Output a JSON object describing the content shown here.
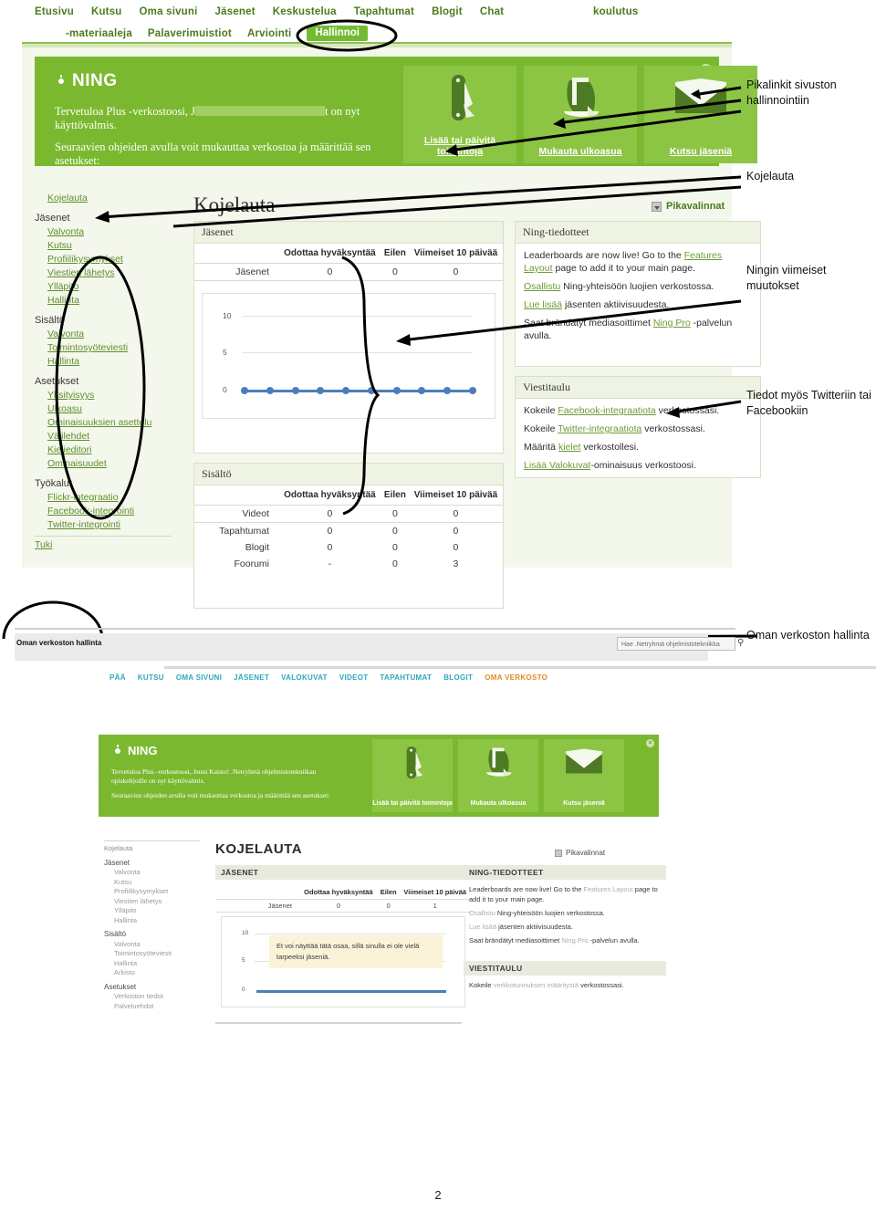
{
  "top_nav": {
    "row1": [
      "Etusivu",
      "Kutsu",
      "Oma sivuni",
      "Jäsenet",
      "Keskustelua",
      "Tapahtumat",
      "Blogit",
      "Chat"
    ],
    "row2": [
      "-materiaaleja",
      "Palaverimuistiot",
      "Arviointi"
    ],
    "right_label": "koulutus",
    "active_tab": "Hallinnoi"
  },
  "shot1": {
    "banner": {
      "logo": "NING",
      "welcome_line1_pre": "Tervetuloa Plus -verkostoosi, J",
      "welcome_line1_post": "t on nyt käyttövalmis.",
      "welcome_line2": "Seuraavien ohjeiden avulla voit mukauttaa verkostoa ja määrittää sen asetukset:",
      "close": "×",
      "tiles": [
        {
          "icon": "pocketknife-icon",
          "label": "Lisää tai päivitä toimintoja"
        },
        {
          "icon": "paint-bucket-icon",
          "label": "Mukauta ulkoasua"
        },
        {
          "icon": "envelope-icon",
          "label": "Kutsu jäseniä"
        }
      ]
    },
    "sidebar": [
      {
        "type": "link",
        "label": "Kojelauta"
      },
      {
        "type": "group",
        "label": "Jäsenet"
      },
      {
        "type": "link",
        "label": "Valvonta"
      },
      {
        "type": "link",
        "label": "Kutsu"
      },
      {
        "type": "link",
        "label": "Profiilikysymykset"
      },
      {
        "type": "link",
        "label": "Viestien lähetys"
      },
      {
        "type": "link",
        "label": "Ylläpito"
      },
      {
        "type": "link",
        "label": "Hallinta"
      },
      {
        "type": "group",
        "label": "Sisältö"
      },
      {
        "type": "link",
        "label": "Valvonta"
      },
      {
        "type": "link",
        "label": "Toimintosyöteviesti"
      },
      {
        "type": "link",
        "label": "Hallinta"
      },
      {
        "type": "group",
        "label": "Asetukset"
      },
      {
        "type": "link",
        "label": "Yksityisyys"
      },
      {
        "type": "link",
        "label": "Ulkoasu"
      },
      {
        "type": "link",
        "label": "Ominaisuuksien asettelu"
      },
      {
        "type": "link",
        "label": "Välilehdet"
      },
      {
        "type": "link",
        "label": "Kielieditori"
      },
      {
        "type": "link",
        "label": "Ominaisuudet"
      },
      {
        "type": "group",
        "label": "Työkalut"
      },
      {
        "type": "link",
        "label": "Flickr-integraatio"
      },
      {
        "type": "link",
        "label": "Facebook-integrointi"
      },
      {
        "type": "link",
        "label": "Twitter-integrointi"
      },
      {
        "type": "link0",
        "label": "Tuki"
      }
    ],
    "dashboard_title": "Kojelauta",
    "quick_links": "Pikavalinnat",
    "members_panel": {
      "title": "Jäsenet",
      "headers": [
        "",
        "Odottaa hyväksyntää",
        "Eilen",
        "Viimeiset 10 päivää"
      ],
      "rows": [
        [
          "Jäsenet",
          "0",
          "0",
          "0"
        ]
      ]
    },
    "content_panel": {
      "title": "Sisältö",
      "headers": [
        "",
        "Odottaa hyväksyntää",
        "Eilen",
        "Viimeiset 10 päivää"
      ],
      "rows": [
        [
          "Videot",
          "0",
          "0",
          "0"
        ],
        [
          "Tapahtumat",
          "0",
          "0",
          "0"
        ],
        [
          "Blogit",
          "0",
          "0",
          "0"
        ],
        [
          "Foorumi",
          "-",
          "0",
          "3"
        ]
      ]
    },
    "ning_panel": {
      "title": "Ning-tiedotteet",
      "lines": [
        {
          "pre": "Leaderboards are now live! Go to the ",
          "link": "Features Layout",
          "post": " page to add it to your main page."
        },
        {
          "pre": "",
          "link": "Osallistu",
          "post": " Ning-yhteisöön luojien verkostossa."
        },
        {
          "pre": "",
          "link": "Lue lisää",
          "post": " jäsenten aktiivisuudesta."
        },
        {
          "pre": "Saat brändätyt mediasoittimet ",
          "link": "Ning Pro",
          "post": " -palvelun avulla."
        }
      ]
    },
    "message_panel": {
      "title": "Viestitaulu",
      "lines": [
        {
          "pre": "Kokeile ",
          "link": "Facebook-integraatiota",
          "post": " verkostossasi."
        },
        {
          "pre": "Kokeile ",
          "link": "Twitter-integraatiota",
          "post": " verkostossasi."
        },
        {
          "pre": "Määritä ",
          "link": "kielet",
          "post": " verkostollesi."
        },
        {
          "pre": "",
          "link": "Lisää Valokuvat",
          "post": "-ominaisuus verkostoosi."
        }
      ]
    },
    "chart_data": {
      "type": "line",
      "title": "Jäsenet",
      "x": [
        1,
        2,
        3,
        4,
        5,
        6,
        7,
        8,
        9,
        10
      ],
      "values": [
        0,
        0,
        0,
        0,
        0,
        0,
        0,
        0,
        0,
        0
      ],
      "yticks": [
        "10",
        "5",
        "0"
      ],
      "ylim": [
        0,
        10
      ],
      "xlabel": "",
      "ylabel": "",
      "grid": true,
      "legend": "none",
      "series_color": "#4a7ebb"
    }
  },
  "annotations": [
    {
      "id": "anno-1",
      "text": "Pikalinkit sivuston hallinnointiin"
    },
    {
      "id": "anno-2",
      "text": "Kojelauta"
    },
    {
      "id": "anno-3",
      "text": "Ningin viimeiset muutokset"
    },
    {
      "id": "anno-4",
      "text": "Tiedot myös Twitteriin tai Facebookiin"
    },
    {
      "id": "anno-5",
      "text": "Oman verkoston hallinta"
    }
  ],
  "shot2": {
    "banner_title": "Oman verkoston hallinta",
    "search_placeholder": "Hae .Netryhmä ohjelmistotekniikka",
    "search_icon": "magnifier-icon",
    "nav": [
      {
        "label": "PÄÄ",
        "active": false
      },
      {
        "label": "KUTSU",
        "active": false
      },
      {
        "label": "OMA SIVUNI",
        "active": false
      },
      {
        "label": "JÄSENET",
        "active": false
      },
      {
        "label": "VALOKUVAT",
        "active": false
      },
      {
        "label": "VIDEOT",
        "active": false
      },
      {
        "label": "TAPAHTUMAT",
        "active": false
      },
      {
        "label": "BLOGIT",
        "active": false
      },
      {
        "label": "OMA VERKOSTO",
        "active": true
      }
    ]
  },
  "shot3": {
    "banner": {
      "logo": "NING",
      "welcome_line1": "Tervetuloa Plus -verkostoosi, Jenni Kaisto! .Netryhmä ohjelmistotekniikan opiskelijoille on nyt käyttövalmis.",
      "welcome_line2": "Seuraavien ohjeiden avulla voit mukauttaa verkostoa ja määrittää sen asetukset:",
      "close": "×",
      "tiles": [
        {
          "icon": "pocketknife-icon",
          "label": "Lisää tai päivitä toimintoja"
        },
        {
          "icon": "paint-bucket-icon",
          "label": "Mukauta ulkoasua"
        },
        {
          "icon": "envelope-icon",
          "label": "Kutsu jäseniä"
        }
      ]
    },
    "sidebar": [
      {
        "type": "link0",
        "label": "Kojelauta"
      },
      {
        "type": "group",
        "label": "Jäsenet"
      },
      {
        "type": "link",
        "label": "Valvonta"
      },
      {
        "type": "link",
        "label": "Kutsu"
      },
      {
        "type": "link",
        "label": "Profiilikysymykset"
      },
      {
        "type": "link",
        "label": "Viestien lähetys"
      },
      {
        "type": "link",
        "label": "Ylläpito"
      },
      {
        "type": "link",
        "label": "Hallinta"
      },
      {
        "type": "group",
        "label": "Sisältö"
      },
      {
        "type": "link",
        "label": "Valvonta"
      },
      {
        "type": "link",
        "label": "Toimintosyöteviesti"
      },
      {
        "type": "link",
        "label": "Hallinta"
      },
      {
        "type": "link",
        "label": "Arkisto"
      },
      {
        "type": "group",
        "label": "Asetukset"
      },
      {
        "type": "link",
        "label": "Verkoston tiedot"
      },
      {
        "type": "link",
        "label": "Palveluehdot"
      }
    ],
    "dashboard_title": "KOJELAUTA",
    "quick_links": "Pikavalinnat",
    "members_panel": {
      "title": "JÄSENET",
      "headers": [
        "",
        "Odottaa hyväksyntää",
        "Eilen",
        "Viimeiset 10 päivää"
      ],
      "rows": [
        [
          "Jäsenet",
          "0",
          "0",
          "1"
        ]
      ],
      "empty_message": "Et voi näyttää tätä osaa, sillä sinulla ei ole vielä tarpeeksi jäseniä."
    },
    "ning_panel": {
      "title": "NING-TIEDOTTEET",
      "lines": [
        {
          "pre": "Leaderboards are now live! Go to the ",
          "link": "Features Layout",
          "post": " page to add it to your main page."
        },
        {
          "pre": "",
          "link": "Osallistu",
          "post": " Ning-yhteisöön luojien verkostossa."
        },
        {
          "pre": "",
          "link": "Lue lisää",
          "post": " jäsenten aktiivisuudesta."
        },
        {
          "pre": "Saat brändätyt mediasoittimet ",
          "link": "Ning Pro",
          "post": " -palvelun avulla."
        }
      ]
    },
    "message_panel": {
      "title": "VIESTITAULU",
      "lines": [
        {
          "pre": "Kokeile ",
          "link": "verkkotunnuksen määritystä",
          "post": " verkostossasi."
        }
      ]
    },
    "chart_data": {
      "type": "line",
      "title": "Jäsenet",
      "x": [
        1,
        2,
        3,
        4,
        5,
        6,
        7,
        8,
        9,
        10
      ],
      "values": [
        0,
        0,
        0,
        0,
        0,
        0,
        0,
        0,
        0,
        0
      ],
      "yticks": [
        "10",
        "5",
        "0"
      ],
      "ylim": [
        0,
        10
      ],
      "grid": true,
      "series_color": "#4a7ebb"
    }
  },
  "page_number": "2",
  "colors": {
    "ning_green": "#7ab92f",
    "tile_green": "#8cc544",
    "nav_green": "#4b7a1e",
    "link_green": "#6d9b37",
    "chart_blue": "#4a7ebb",
    "teal": "#2fa8b8",
    "orange": "#e08b20"
  }
}
